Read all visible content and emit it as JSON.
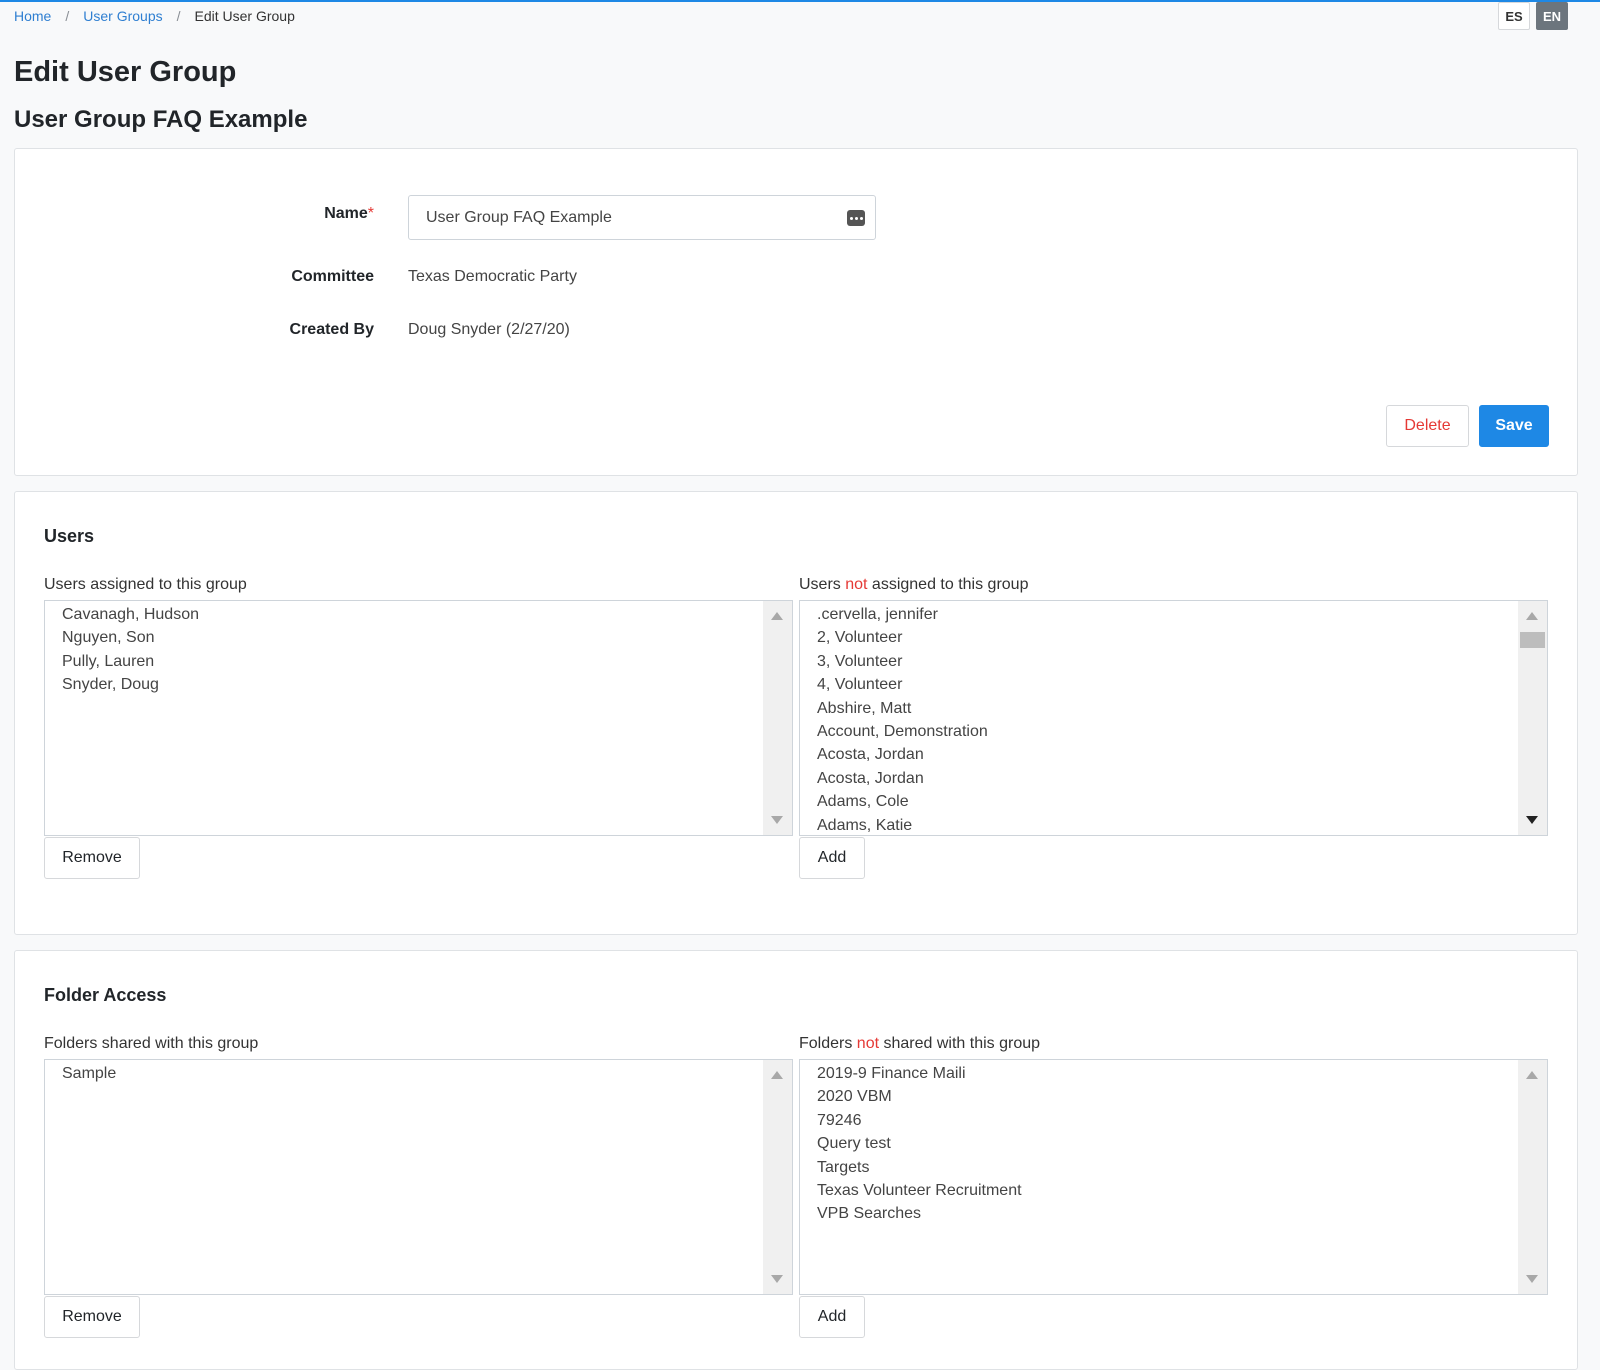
{
  "breadcrumb": {
    "items": [
      "Home",
      "User Groups"
    ],
    "separator": "/",
    "current": "Edit User Group"
  },
  "language": {
    "es": "ES",
    "en": "EN",
    "active": "EN"
  },
  "page": {
    "title": "Edit User Group",
    "subtitle": "User Group FAQ Example"
  },
  "form": {
    "name_label": "Name",
    "required_mark": "*",
    "name_value": "User Group FAQ Example",
    "committee_label": "Committee",
    "committee_value": "Texas Democratic Party",
    "created_by_label": "Created By",
    "created_by_value": "Doug Snyder (2/27/20)",
    "delete_label": "Delete",
    "save_label": "Save"
  },
  "users": {
    "title": "Users",
    "assigned_label": "Users assigned to this group",
    "unassigned_label_pre": "Users ",
    "unassigned_label_not": "not",
    "unassigned_label_post": " assigned to this group",
    "assigned": [
      "Cavanagh, Hudson",
      "Nguyen, Son",
      "Pully, Lauren",
      "Snyder, Doug"
    ],
    "unassigned": [
      ".cervella, jennifer",
      "2, Volunteer",
      "3, Volunteer",
      "4, Volunteer",
      "Abshire, Matt",
      "Account, Demonstration",
      "Acosta, Jordan",
      "Acosta, Jordan",
      "Adams, Cole",
      "Adams, Katie"
    ],
    "remove_label": "Remove",
    "add_label": "Add"
  },
  "folders": {
    "title": "Folder Access",
    "shared_label": "Folders shared with this group",
    "unshared_label_pre": "Folders ",
    "unshared_label_not": "not",
    "unshared_label_post": " shared with this group",
    "shared": [
      "Sample"
    ],
    "unshared": [
      "2019-9 Finance Maili",
      "2020 VBM",
      "79246",
      "Query test",
      "Targets",
      "Texas Volunteer Recruitment",
      "VPB Searches"
    ],
    "remove_label": "Remove",
    "add_label": "Add"
  },
  "colors": {
    "accent": "#1e88e5",
    "link": "#2f7fd1",
    "danger": "#e53935"
  }
}
